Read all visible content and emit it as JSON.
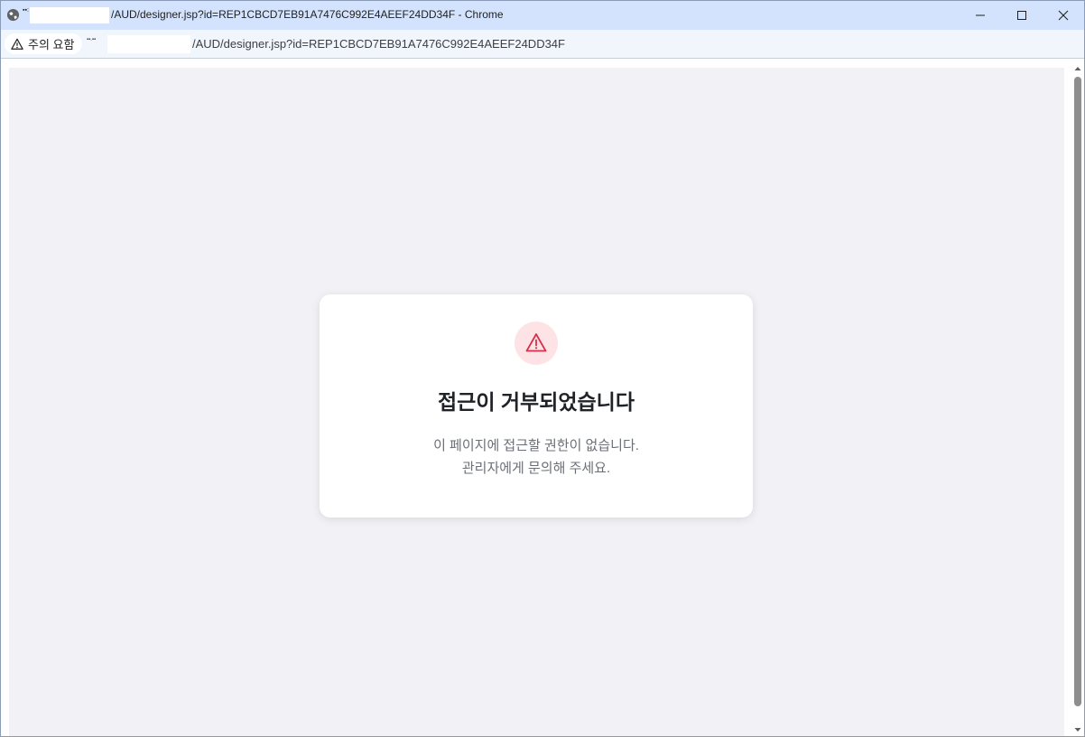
{
  "window": {
    "host_mark": "▪▪:",
    "title_text": "/AUD/designer.jsp?id=REP1CBCD7EB91A7476C992E4AEEF24DD34F - Chrome",
    "icons": {
      "site": "globe-icon",
      "minimize": "minimize-icon",
      "maximize": "maximize-icon",
      "close": "close-icon"
    }
  },
  "addressbar": {
    "security_chip": {
      "icon": "warning-icon",
      "label": "주의 요함"
    },
    "host_mark": "▪▪.▪▪",
    "url_path": "/AUD/designer.jsp?id=REP1CBCD7EB91A7476C992E4AEEF24DD34F"
  },
  "page": {
    "card": {
      "icon": "alert-triangle-icon",
      "title": "접근이 거부되었습니다",
      "message_line1": "이 페이지에 접근할 권한이 없습니다.",
      "message_line2": "관리자에게 문의해 주세요."
    }
  },
  "colors": {
    "titlebar_bg": "#d3e3fd",
    "page_bg": "#f2f2f6",
    "alert_red": "#d6314a",
    "alert_circle_bg": "#fde3e6",
    "title_text": "#1f2328",
    "message_text": "#6b6f76"
  }
}
